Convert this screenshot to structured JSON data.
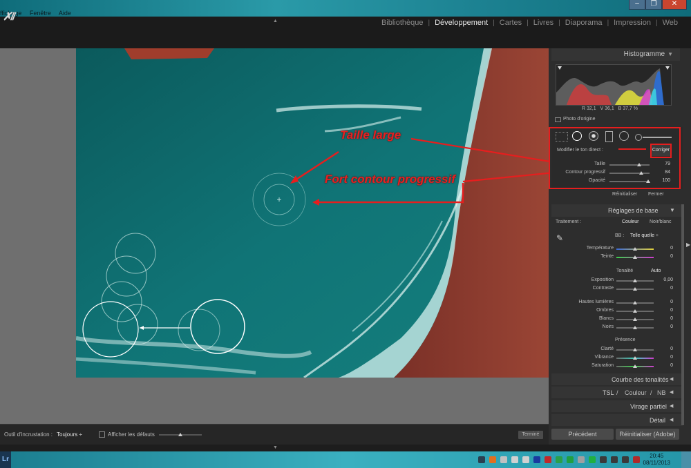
{
  "os_menu": [
    "ffichage",
    "Fenêtre",
    "Aide"
  ],
  "window_buttons": [
    "‒",
    "❐",
    "✕"
  ],
  "app": {
    "logo_text": "Lr"
  },
  "modules": [
    {
      "label": "Bibliothèque",
      "active": false
    },
    {
      "label": "Développement",
      "active": true
    },
    {
      "label": "Cartes",
      "active": false
    },
    {
      "label": "Livres",
      "active": false
    },
    {
      "label": "Diaporama",
      "active": false
    },
    {
      "label": "Impression",
      "active": false
    },
    {
      "label": "Web",
      "active": false
    }
  ],
  "annotations": {
    "large_size": "Taille large",
    "strong_feather": "Fort contour progressif"
  },
  "histogram": {
    "title": "Histogramme",
    "rgb_readout": {
      "r_label": "R",
      "r": "32,1",
      "v_label": "V",
      "v": "36,1",
      "b_label": "B",
      "b": "37,7",
      "unit": "%"
    },
    "original_photo_label": "Photo d'origine"
  },
  "spot_tool": {
    "modify_label": "Modifier le ton direct :",
    "mode_label": "Corriger",
    "sliders": [
      {
        "label": "Taille",
        "value": "79",
        "pos": 0.79
      },
      {
        "label": "Contour progressif",
        "value": "84",
        "pos": 0.84
      },
      {
        "label": "Opacité",
        "value": "100",
        "pos": 1.0
      }
    ],
    "reset_label": "Réinitialiser",
    "close_label": "Fermer"
  },
  "basic_panel": {
    "title": "Réglages de base",
    "treatment_label": "Traitement :",
    "treatment_color": "Couleur",
    "treatment_bw": "Noir/blanc",
    "wb_label": "BB :",
    "wb_value": "Telle quelle ÷",
    "temp": {
      "label": "Température",
      "value": "0"
    },
    "tint": {
      "label": "Teinte",
      "value": "0"
    },
    "tone_label": "Tonalité",
    "auto_label": "Auto",
    "tone_sliders": [
      {
        "label": "Exposition",
        "value": "0,00"
      },
      {
        "label": "Contraste",
        "value": "0"
      }
    ],
    "light_sliders": [
      {
        "label": "Hautes lumières",
        "value": "0"
      },
      {
        "label": "Ombres",
        "value": "0"
      },
      {
        "label": "Blancs",
        "value": "0"
      },
      {
        "label": "Noirs",
        "value": "0"
      }
    ],
    "presence_label": "Présence",
    "presence_sliders": [
      {
        "label": "Clarté",
        "value": "0"
      },
      {
        "label": "Vibrance",
        "value": "0"
      },
      {
        "label": "Saturation",
        "value": "0"
      }
    ]
  },
  "collapsed_panels": {
    "tone_curve": "Courbe des tonalités",
    "tsl": "TSL",
    "tsl_sep": "/",
    "color": "Couleur",
    "bw": "NB",
    "split_toning": "Virage partiel",
    "detail": "Détail"
  },
  "bottom_buttons": {
    "previous": "Précédent",
    "reset_adobe": "Réinitialiser (Adobe)"
  },
  "toolbar": {
    "overlay_label": "Outil d'incrustation :",
    "overlay_value": "Toujours ÷",
    "show_defaults_label": "Afficher les défauts",
    "done_label": "Terminé"
  },
  "taskbar": {
    "lr_label": "Lr",
    "time": "20:45",
    "date": "08/11/2013"
  },
  "colors": {
    "annotation_red": "#e61e1e",
    "panel_bg": "#2d2d2d",
    "canvas_gray": "#6f6f6f",
    "sea": "#0f6e70",
    "sand": "#8a3a2e"
  }
}
